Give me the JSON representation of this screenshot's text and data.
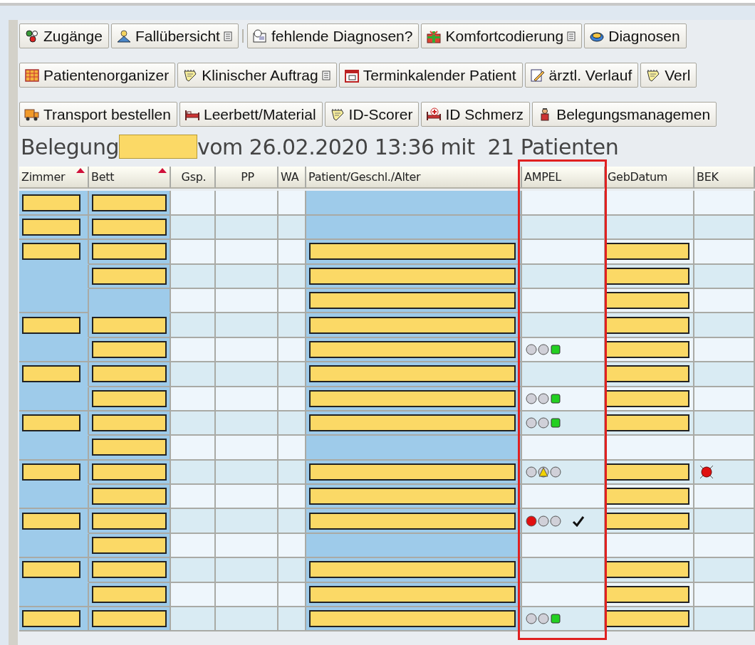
{
  "toolbar_rows": [
    {
      "buttons": [
        {
          "kind": "people",
          "label": "Zugänge",
          "has_menu": false
        },
        {
          "kind": "person",
          "label": "Fallübersicht",
          "has_menu": true
        },
        {
          "kind": "question",
          "label": "fehlende Diagnosen?",
          "has_menu": false
        },
        {
          "kind": "gift",
          "label": "Komfortcodierung",
          "has_menu": true
        },
        {
          "kind": "disk",
          "label": "Diagnosen",
          "has_menu": false
        }
      ]
    },
    {
      "buttons": [
        {
          "kind": "grid",
          "label": "Patientenorganizer",
          "has_menu": false
        },
        {
          "kind": "notepad",
          "label": "Klinischer Auftrag",
          "has_menu": true
        },
        {
          "kind": "calendar",
          "label": "Terminkalender Patient",
          "has_menu": false
        },
        {
          "kind": "pencil",
          "label": "ärztl. Verlauf",
          "has_menu": false
        },
        {
          "kind": "notepad",
          "label": "Verl",
          "has_menu": false
        }
      ]
    },
    {
      "buttons": [
        {
          "kind": "truck",
          "label": "Transport bestellen",
          "has_menu": false
        },
        {
          "kind": "bed",
          "label": "Leerbett/Material",
          "has_menu": false
        },
        {
          "kind": "notepad",
          "label": "ID-Scorer",
          "has_menu": false
        },
        {
          "kind": "bedcross",
          "label": "ID Schmerz",
          "has_menu": false
        },
        {
          "kind": "person-red",
          "label": "Belegungsmanagemen",
          "has_menu": false
        }
      ]
    }
  ],
  "title": {
    "prefix": "Belegung",
    "suffix": "vom 26.02.2020 13:36 mit  21 Patienten"
  },
  "table": {
    "columns": [
      {
        "label": "Zimmer",
        "sorted": true,
        "highlighted": false
      },
      {
        "label": "Bett",
        "sorted": true,
        "highlighted": false
      },
      {
        "label": "Gsp.",
        "sorted": false,
        "highlighted": false
      },
      {
        "label": "PP",
        "sorted": false,
        "highlighted": false
      },
      {
        "label": "WA",
        "sorted": false,
        "highlighted": false
      },
      {
        "label": "Patient/Geschl./Alter",
        "sorted": false,
        "highlighted": false
      },
      {
        "label": "AMPEL",
        "sorted": false,
        "highlighted": true
      },
      {
        "label": "GebDatum",
        "sorted": false,
        "highlighted": false
      },
      {
        "label": "BEK",
        "sorted": false,
        "highlighted": false
      }
    ],
    "rows": [
      {
        "zimmer": true,
        "bett": true,
        "patient": false,
        "checked": false,
        "gebdatum": false,
        "bek_alert": false
      },
      {
        "zimmer": true,
        "bett": true,
        "patient": false,
        "checked": false,
        "gebdatum": false,
        "bek_alert": false
      },
      {
        "zimmer": true,
        "bett": true,
        "patient": true,
        "checked": false,
        "gebdatum": true,
        "bek_alert": false
      },
      {
        "zimmer": false,
        "bett": true,
        "patient": true,
        "checked": false,
        "gebdatum": true,
        "bek_alert": false
      },
      {
        "zimmer": false,
        "bett": false,
        "patient": true,
        "checked": false,
        "gebdatum": true,
        "bek_alert": false
      },
      {
        "zimmer": true,
        "bett": true,
        "patient": true,
        "checked": false,
        "gebdatum": true,
        "bek_alert": false
      },
      {
        "zimmer": false,
        "bett": true,
        "patient": true,
        "ampel": {
          "kind": "green"
        },
        "checked": false,
        "gebdatum": true,
        "bek_alert": false
      },
      {
        "zimmer": true,
        "bett": true,
        "patient": true,
        "checked": false,
        "gebdatum": true,
        "bek_alert": false
      },
      {
        "zimmer": false,
        "bett": true,
        "patient": true,
        "ampel": {
          "kind": "green"
        },
        "checked": false,
        "gebdatum": true,
        "bek_alert": false
      },
      {
        "zimmer": true,
        "bett": true,
        "patient": true,
        "ampel": {
          "kind": "green"
        },
        "checked": false,
        "gebdatum": true,
        "bek_alert": false
      },
      {
        "zimmer": false,
        "bett": true,
        "patient": false,
        "checked": false,
        "gebdatum": false,
        "bek_alert": false
      },
      {
        "zimmer": true,
        "bett": true,
        "patient": true,
        "ampel": {
          "kind": "yellow"
        },
        "checked": false,
        "gebdatum": true,
        "bek_alert": true
      },
      {
        "zimmer": false,
        "bett": true,
        "patient": true,
        "checked": false,
        "gebdatum": true,
        "bek_alert": false
      },
      {
        "zimmer": true,
        "bett": true,
        "patient": true,
        "ampel": {
          "kind": "red"
        },
        "checked": true,
        "gebdatum": true,
        "bek_alert": false
      },
      {
        "zimmer": false,
        "bett": true,
        "patient": false,
        "checked": false,
        "gebdatum": false,
        "bek_alert": false
      },
      {
        "zimmer": true,
        "bett": true,
        "patient": true,
        "checked": false,
        "gebdatum": true,
        "bek_alert": false
      },
      {
        "zimmer": false,
        "bett": true,
        "patient": true,
        "checked": false,
        "gebdatum": true,
        "bek_alert": false
      },
      {
        "zimmer": true,
        "bett": true,
        "patient": true,
        "ampel": {
          "kind": "green"
        },
        "checked": false,
        "gebdatum": true,
        "bek_alert": false
      }
    ]
  }
}
